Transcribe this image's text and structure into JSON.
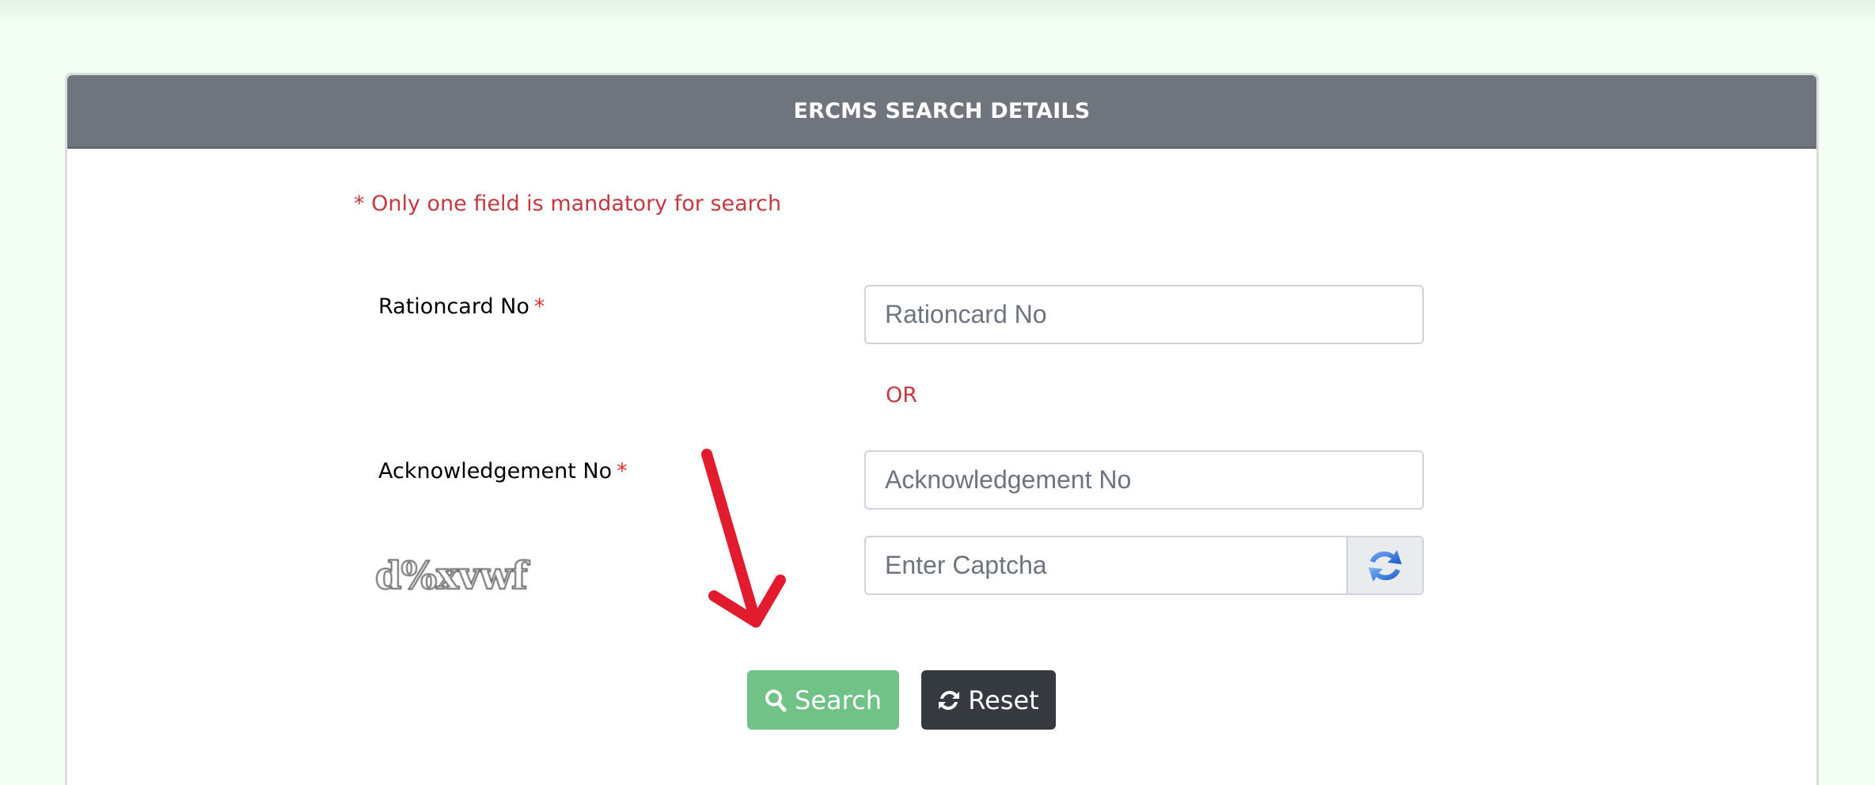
{
  "card": {
    "title": "ERCMS SEARCH DETAILS"
  },
  "form": {
    "note": "* Only one field is mandatory for search",
    "rationcard": {
      "label": "Rationcard No",
      "required_marker": "*",
      "placeholder": "Rationcard No",
      "value": ""
    },
    "separator": "OR",
    "acknowledgement": {
      "label": "Acknowledgement No",
      "required_marker": "*",
      "placeholder": "Acknowledgement No",
      "value": ""
    },
    "captcha": {
      "image_text": "d%xvwf",
      "placeholder": "Enter Captcha",
      "value": "",
      "refresh_icon": "refresh-icon"
    }
  },
  "actions": {
    "search_label": "Search",
    "search_icon": "search-icon",
    "reset_label": "Reset",
    "reset_icon": "sync-icon"
  },
  "annotation": {
    "type": "arrow",
    "color": "#e31b2e",
    "points_to": "search-button"
  },
  "colors": {
    "page_bg": "#f3fff2",
    "header_bg": "#6e757c",
    "note_red": "#c6373f",
    "search_green": "#70c287",
    "reset_dark": "#343a40"
  }
}
